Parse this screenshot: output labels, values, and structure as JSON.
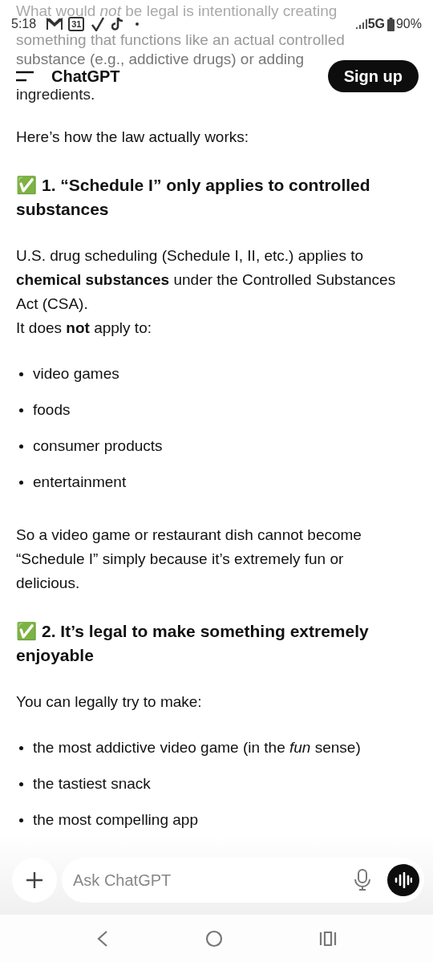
{
  "status_bar": {
    "time": "5:18",
    "calendar_badge": "31",
    "network": "5G",
    "battery": "90%"
  },
  "header": {
    "title": "ChatGPT",
    "signup": "Sign up"
  },
  "faded_lines": [
    "What would *not* be legal is intentionally creating",
    "something that functions like an actual controlled",
    "substance (e.g., addictive drugs) or adding",
    "ingredients."
  ],
  "blocks": [
    {
      "kind": "para",
      "text": "Here’s how the law actually works:"
    },
    {
      "kind": "heading",
      "emoji": "✅",
      "text": "1. “Schedule I” only applies to controlled substances"
    },
    {
      "kind": "para",
      "text": "U.S. drug scheduling (Schedule I, II, etc.) applies to **chemical substances** under the Controlled Substances Act (CSA).\nIt does **not** apply to:"
    },
    {
      "kind": "bullets",
      "items": [
        "video games",
        "foods",
        "consumer products",
        "entertainment"
      ]
    },
    {
      "kind": "para",
      "text": "So a video game or restaurant dish cannot become “Schedule I” simply because it’s extremely fun or delicious."
    },
    {
      "kind": "heading",
      "emoji": "✅",
      "text": "2. It’s legal to make something extremely enjoyable"
    },
    {
      "kind": "para",
      "text": "You can legally try to make:"
    },
    {
      "kind": "bullets",
      "items": [
        "the most addictive video game (in the *fun* sense)",
        "the tastiest snack",
        "the most compelling app"
      ]
    }
  ],
  "composer": {
    "placeholder": "Ask ChatGPT"
  }
}
